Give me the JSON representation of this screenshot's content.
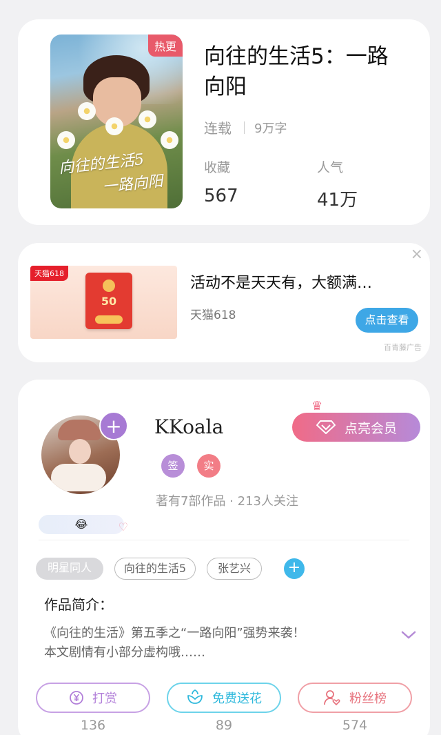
{
  "book": {
    "hot_badge": "热更",
    "title": "向往的生活5：一路向阳",
    "status": "连载",
    "word_count": "9万字",
    "favorites_label": "收藏",
    "favorites_value": "567",
    "popularity_label": "人气",
    "popularity_value": "41万",
    "cover_title_line1": "向往的生活5",
    "cover_title_line2": "一路向阳"
  },
  "ad": {
    "close": "×",
    "badge": "天猫618",
    "amount": "50",
    "title": "活动不是天天有，大额满…",
    "source": "天猫618",
    "cta": "点击查看",
    "ad_tag": "百青藤广告"
  },
  "author": {
    "name": "KKoala",
    "add": "+",
    "badge_sign": "签",
    "badge_real": "实",
    "meta": "著有7部作品 · 213人关注",
    "vip_button": "点亮会员",
    "emoji": "😂",
    "tags": [
      "明星同人",
      "向往的生活5",
      "张艺兴"
    ],
    "tag_add": "+",
    "intro_heading": "作品简介：",
    "intro_line1": "《向往的生活》第五季之“一路向阳”强势来袭！",
    "intro_line2": "本文剧情有小部分虚构哦……"
  },
  "actions": {
    "reward_label": "打赏",
    "reward_count": "136",
    "flower_label": "免费送花",
    "flower_count": "89",
    "fans_label": "粉丝榜",
    "fans_count": "574"
  },
  "colors": {
    "vip_gradient_start": "#f06b87",
    "vip_gradient_end": "#b68ad9",
    "cta_blue": "#3ea7e6",
    "hot_badge": "#e85a6a"
  },
  "icons": {
    "reward": "yen-coin-icon",
    "flower": "flower-icon",
    "fans": "user-heart-icon",
    "vip": "diamond-icon",
    "crown": "crown-icon",
    "expand": "chevron-down-icon"
  }
}
